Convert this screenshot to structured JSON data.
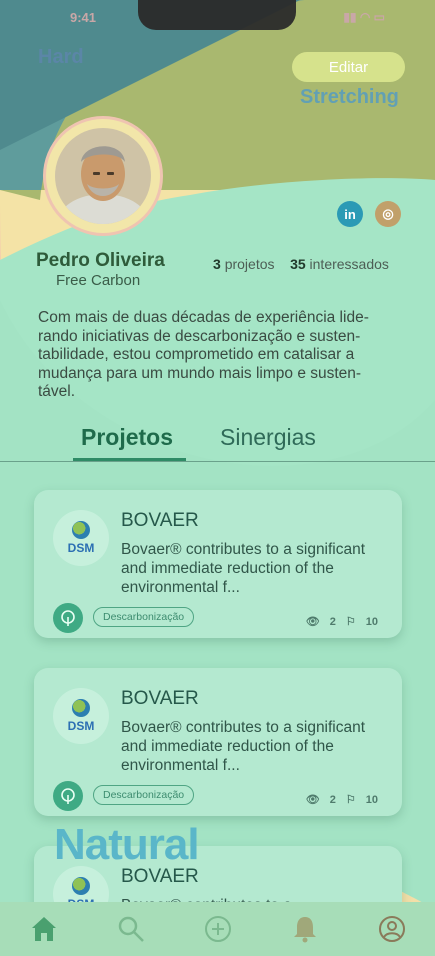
{
  "status": {
    "time": "9:41",
    "icons": "▮▮ ◠ ▭"
  },
  "labels": {
    "hard": "Hard",
    "stretching": "Stretching",
    "natural": "Natural"
  },
  "header": {
    "edit_label": "Editar"
  },
  "profile": {
    "name": "Pedro Oliveira",
    "company": "Free Carbon",
    "projects_count": "3",
    "projects_label": "projetos",
    "interested_count": "35",
    "interested_label": "interessados",
    "bio": "Com mais de duas décadas de experiência lide-\nrando iniciativas de descarbonização e susten-\ntabilidade, estou comprometido em catalisar a\nmudança para um mundo mais limpo e susten-\ntável."
  },
  "social": {
    "linkedin": "in",
    "instagram": "◎"
  },
  "tabs": {
    "projects": "Projetos",
    "synergies": "Sinergias"
  },
  "cards": [
    {
      "logo_text": "DSM",
      "title": "BOVAER",
      "desc": "Bovaer® contributes to a significant and immediate reduction of the environmental f...",
      "tag": "Descarbonização",
      "views": "2",
      "flags": "10"
    },
    {
      "logo_text": "DSM",
      "title": "BOVAER",
      "desc": "Bovaer® contributes to a significant and immediate reduction of the environmental f...",
      "tag": "Descarbonização",
      "views": "2",
      "flags": "10"
    },
    {
      "logo_text": "DSM",
      "title": "BOVAER",
      "desc": "Bovaer® contributes to a"
    }
  ],
  "colors": {
    "accent": "#2f8b66",
    "background": "#a9e3c8",
    "edit_button": "#d6e28c"
  },
  "nav": {
    "icons": [
      "home-icon",
      "search-icon",
      "add-icon",
      "bell-icon",
      "profile-icon"
    ]
  }
}
